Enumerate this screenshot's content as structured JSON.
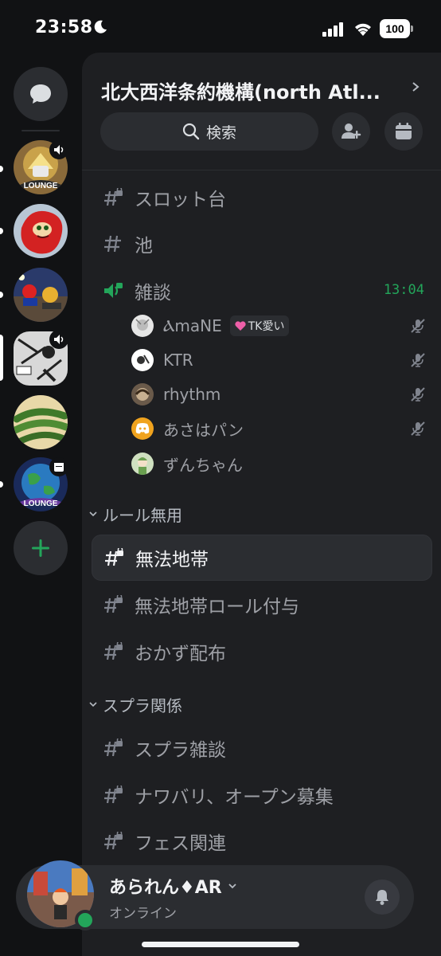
{
  "status_bar": {
    "time": "23:58",
    "battery": "100"
  },
  "rail": {
    "servers": [
      {
        "name": "LOUNGE server",
        "badge": "speaker"
      },
      {
        "name": "knuckles server"
      },
      {
        "name": "racing server"
      },
      {
        "name": "manga server",
        "badge": "speaker"
      },
      {
        "name": "green beans server"
      },
      {
        "name": "earth LOUNGE server",
        "badge": "calendar"
      }
    ]
  },
  "guild": {
    "name": "北大西洋条約機構(north Atl...",
    "search_label": "検索"
  },
  "channels": [
    {
      "name": "スロット台"
    },
    {
      "name": "池"
    },
    {
      "name": "雑談",
      "time": "13:04"
    }
  ],
  "voice_users": [
    {
      "name": "ⲀmaNE",
      "tag": "TK愛い"
    },
    {
      "name": "KTR"
    },
    {
      "name": "rhythm"
    },
    {
      "name": "あさはパン"
    },
    {
      "name": "ずんちゃん"
    }
  ],
  "categories": [
    {
      "name": "ルール無用",
      "channels": [
        "無法地帯",
        "無法地帯ロール付与",
        "おかず配布"
      ]
    },
    {
      "name": "スプラ関係",
      "channels": [
        "スプラ雑談",
        "ナワバリ、オープン募集",
        "フェス関連"
      ]
    }
  ],
  "user": {
    "name": "あられん♦AR",
    "status": "オンライン"
  },
  "colors": {
    "accent_green": "#23a55a",
    "panel": "#1e1f22",
    "rail": "#111214"
  }
}
